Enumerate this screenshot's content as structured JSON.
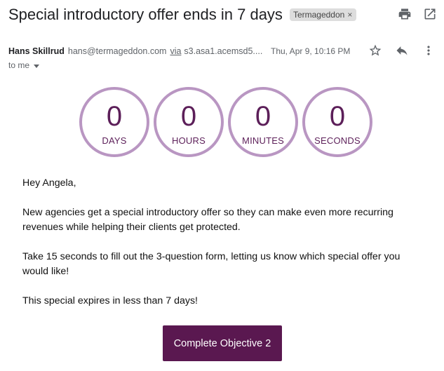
{
  "email": {
    "subject": "Special introductory offer ends in 7 days",
    "label": "Termageddon",
    "sender_name": "Hans Skillrud",
    "sender_email": "hans@termageddon.com",
    "via_label": "via",
    "via_domain": "s3.asa1.acemsd5....",
    "date": "Thu, Apr 9, 10:16 PM",
    "to": "to me"
  },
  "toolbar_icons": [
    "close-icon",
    "print-icon",
    "open-in-new-icon",
    "star-icon",
    "reply-icon",
    "more-vert-icon"
  ],
  "countdown": [
    {
      "value": "0",
      "unit": "DAYS"
    },
    {
      "value": "0",
      "unit": "HOURS"
    },
    {
      "value": "0",
      "unit": "MINUTES"
    },
    {
      "value": "0",
      "unit": "SECONDS"
    }
  ],
  "body": {
    "greeting": "Hey Angela,",
    "p1": "New agencies get a special introductory offer so they can make even more recurring revenues while helping their clients get protected.",
    "p2": "Take 15 seconds to fill out the 3-question form, letting us know which special offer you would like!",
    "p3": "This special expires in less than 7 days!"
  },
  "cta": {
    "label": "Complete Objective 2"
  },
  "colors": {
    "accent": "#5a1850",
    "countdown_ring": "#b996c2",
    "countdown_text": "#5c1f59",
    "chip_bg": "#dddddd"
  }
}
